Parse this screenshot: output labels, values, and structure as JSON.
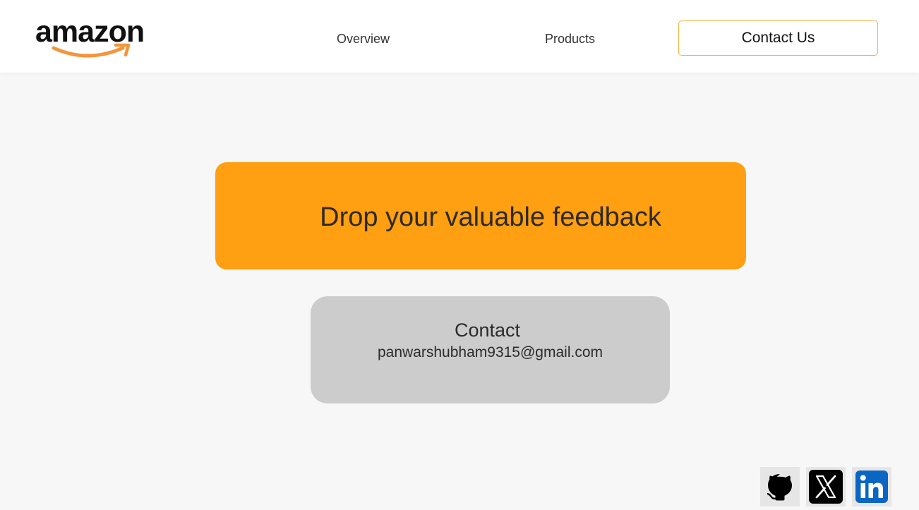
{
  "header": {
    "logo_text": "amazon",
    "nav": {
      "overview": "Overview",
      "products": "Products",
      "contact_us": "Contact Us"
    }
  },
  "banner": {
    "text": "Drop your valuable feedback"
  },
  "contact": {
    "title": "Contact",
    "email": "panwarshubham9315@gmail.com"
  },
  "social": [
    {
      "icon": "github-icon"
    },
    {
      "icon": "x-icon"
    },
    {
      "icon": "linkedin-icon"
    }
  ],
  "colors": {
    "accent_orange": "#ff9f12",
    "contact_button_border": "#f3b542",
    "card_gray": "#cccccc",
    "page_background": "#f7f7f7",
    "linkedin_blue": "#0a66c2"
  }
}
